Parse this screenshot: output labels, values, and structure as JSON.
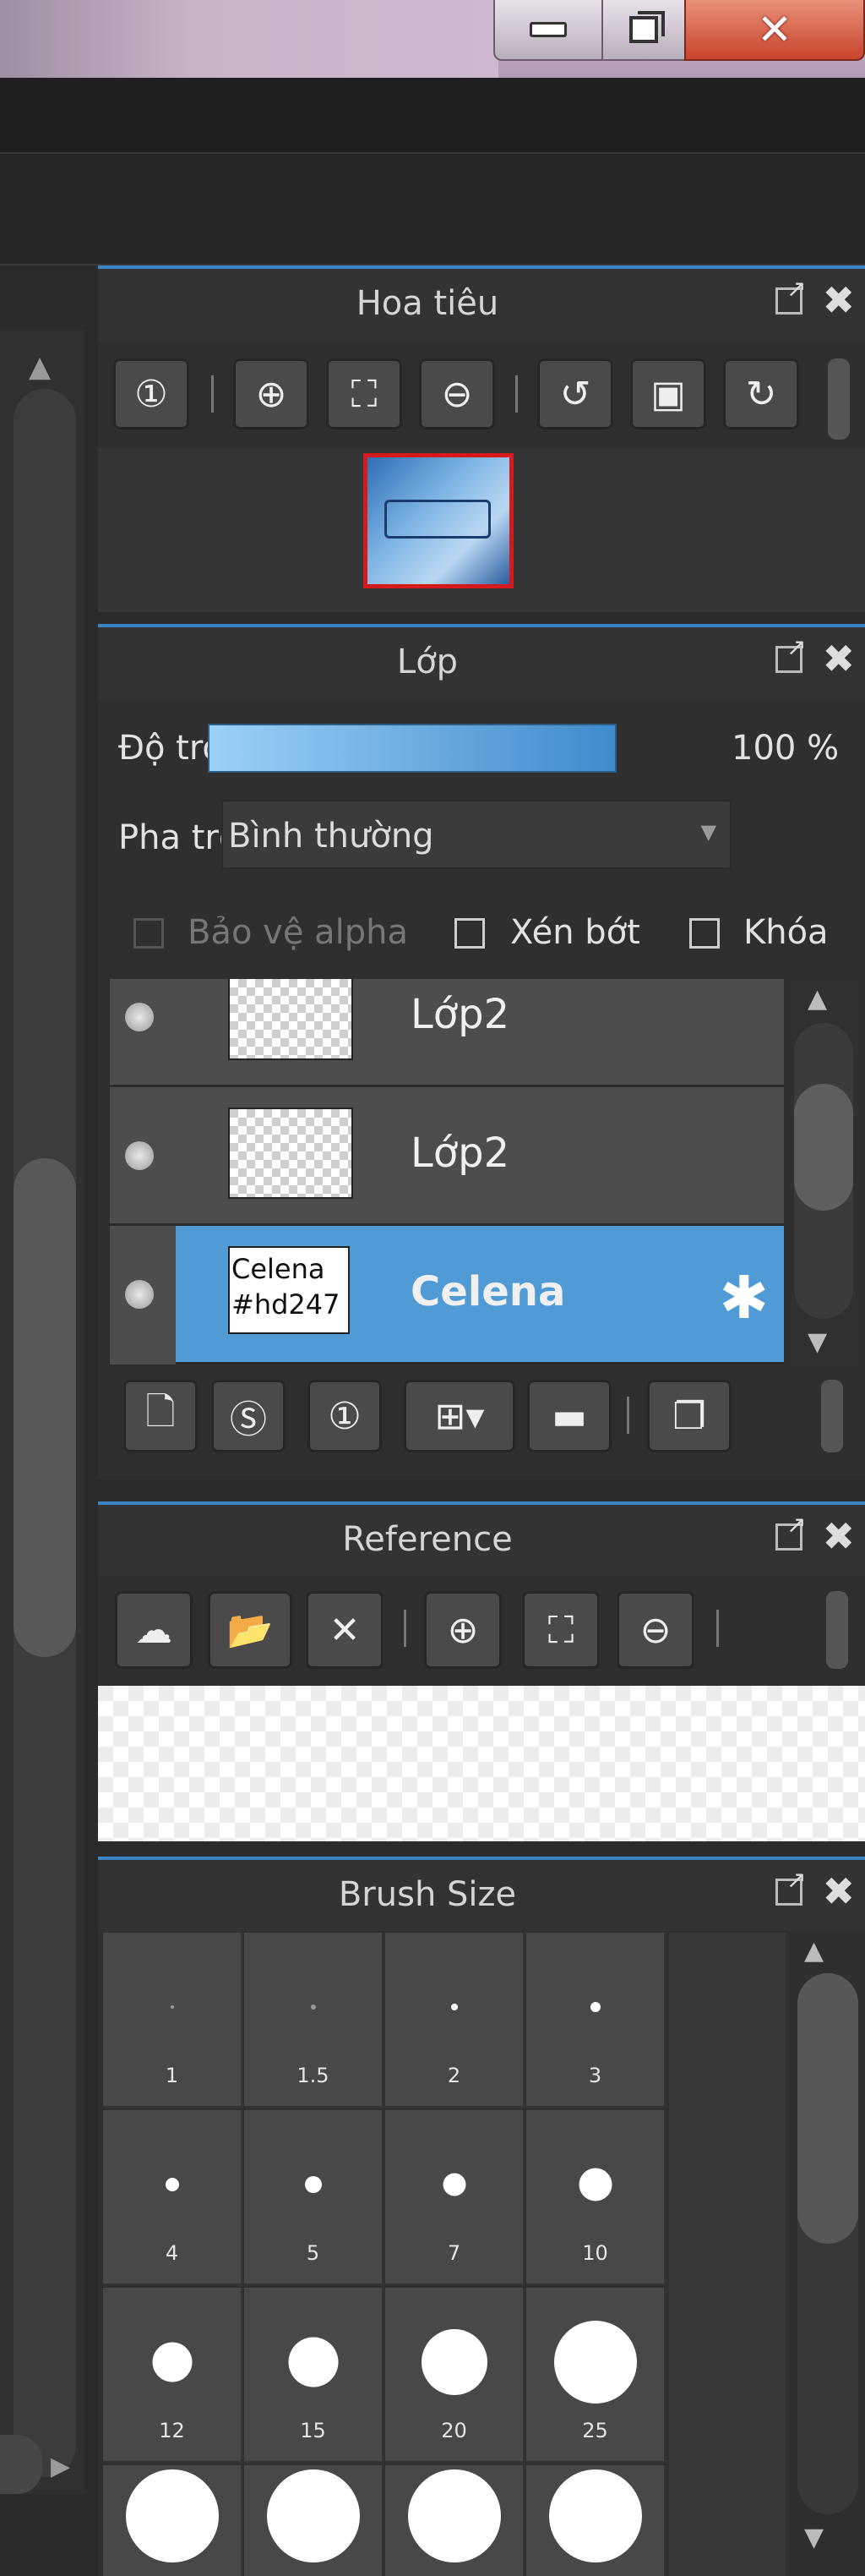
{
  "window": {
    "minimize_icon": "minimize-icon",
    "maximize_icon": "restore-icon",
    "close_icon": "close-icon"
  },
  "navigator": {
    "title": "Hoa tiêu",
    "tools": [
      "zoom-actual-icon",
      "zoom-in-icon",
      "fit-icon",
      "zoom-out-icon",
      "rotate-left-icon",
      "flip-icon",
      "rotate-right-icon"
    ]
  },
  "layer": {
    "title": "Lớp",
    "opacity_label": "Độ trong",
    "opacity_value": "100 %",
    "opacity_fraction": 1.0,
    "blend_label": "Pha trộn",
    "blend_value": "Bình thường",
    "protect_alpha": "Bảo vệ alpha",
    "clipping": "Xén bớt",
    "lock": "Khóa",
    "items": [
      {
        "name": "Lớp2",
        "selected": false
      },
      {
        "name": "Lớp2",
        "selected": false
      },
      {
        "name": "Celena",
        "selected": true,
        "thumb_text_1": "Celena",
        "thumb_text_2": "#hd247"
      }
    ]
  },
  "reference": {
    "title": "Reference"
  },
  "brush_size": {
    "title": "Brush Size",
    "sizes": [
      "1",
      "1.5",
      "2",
      "3",
      "4",
      "5",
      "7",
      "10",
      "12",
      "15",
      "20",
      "25"
    ]
  },
  "accent_color": "#509ad6",
  "panel_border_color": "#3b85c4"
}
